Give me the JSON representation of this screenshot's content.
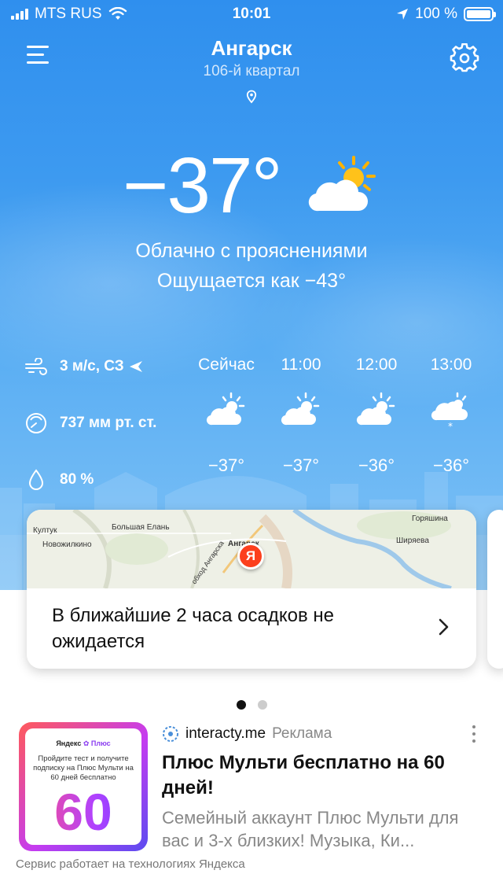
{
  "status_bar": {
    "carrier": "MTS RUS",
    "time": "10:01",
    "battery_percent": "100 %"
  },
  "header": {
    "city": "Ангарск",
    "district": "106-й квартал",
    "menu_icon": "hamburger-menu-icon",
    "settings_icon": "gear-icon",
    "location_icon": "location-pin-icon"
  },
  "current": {
    "temperature": "−37°",
    "condition": "Облачно с прояснениями",
    "feels_like": "Ощущается как −43°",
    "icon": "partly-cloudy-icon"
  },
  "details": {
    "wind": "3 м/с, СЗ",
    "pressure": "737 мм рт. ст.",
    "humidity": "80 %"
  },
  "hourly": [
    {
      "time": "Сейчас",
      "temp": "−37°",
      "icon": "partly-cloudy-icon"
    },
    {
      "time": "11:00",
      "temp": "−37°",
      "icon": "partly-cloudy-icon"
    },
    {
      "time": "12:00",
      "temp": "−36°",
      "icon": "partly-cloudy-icon"
    },
    {
      "time": "13:00",
      "temp": "−36°",
      "icon": "cloudy-snow-icon"
    }
  ],
  "map_card": {
    "labels": [
      "Култук",
      "Большая Елань",
      "Новожилкино",
      "Ангарск",
      "обход Ангарска",
      "Горяшина",
      "Ширяева"
    ],
    "marker": "Я",
    "message": "В ближайшие 2 часа осадков не ожидается"
  },
  "pager": {
    "count": 2,
    "active": 0
  },
  "ad": {
    "source": "interacty.me",
    "tag": "Реклама",
    "thumb_brand": "Яндекс",
    "thumb_brand_accent": "Плюс",
    "thumb_text": "Пройдите тест и получите подписку на Плюс Мульти на 60 дней бесплатно",
    "thumb_number": "60",
    "title": "Плюс Мульти бесплатно на 60 дней!",
    "description": "Семейный аккаунт Плюс Мульти для вас и 3-х близких! Музыка, Ки..."
  },
  "footer": "Сервис работает на технологиях Яндекса",
  "colors": {
    "sky_top": "#2f8fee",
    "sky_bottom": "#7fc2f6",
    "yandex_red": "#fc3f1d",
    "sun": "#ffb300"
  }
}
